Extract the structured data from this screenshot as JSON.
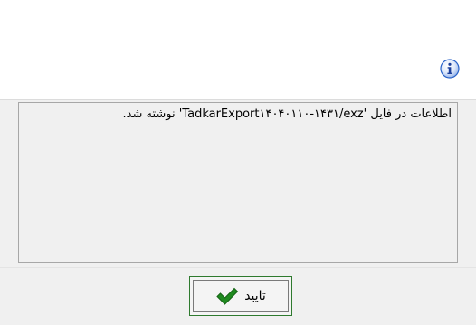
{
  "dialog": {
    "message": "اطلاعات در فایل 'TadkarExport۱۴۰۴۰۱۱۰-۱۴۳۱/exz' نوشته شد.",
    "icon": "info-icon",
    "ok_label": "تایید",
    "ok_icon": "checkmark-icon",
    "colors": {
      "accent": "#2e7a2e",
      "info_blue": "#2a63c9"
    }
  }
}
